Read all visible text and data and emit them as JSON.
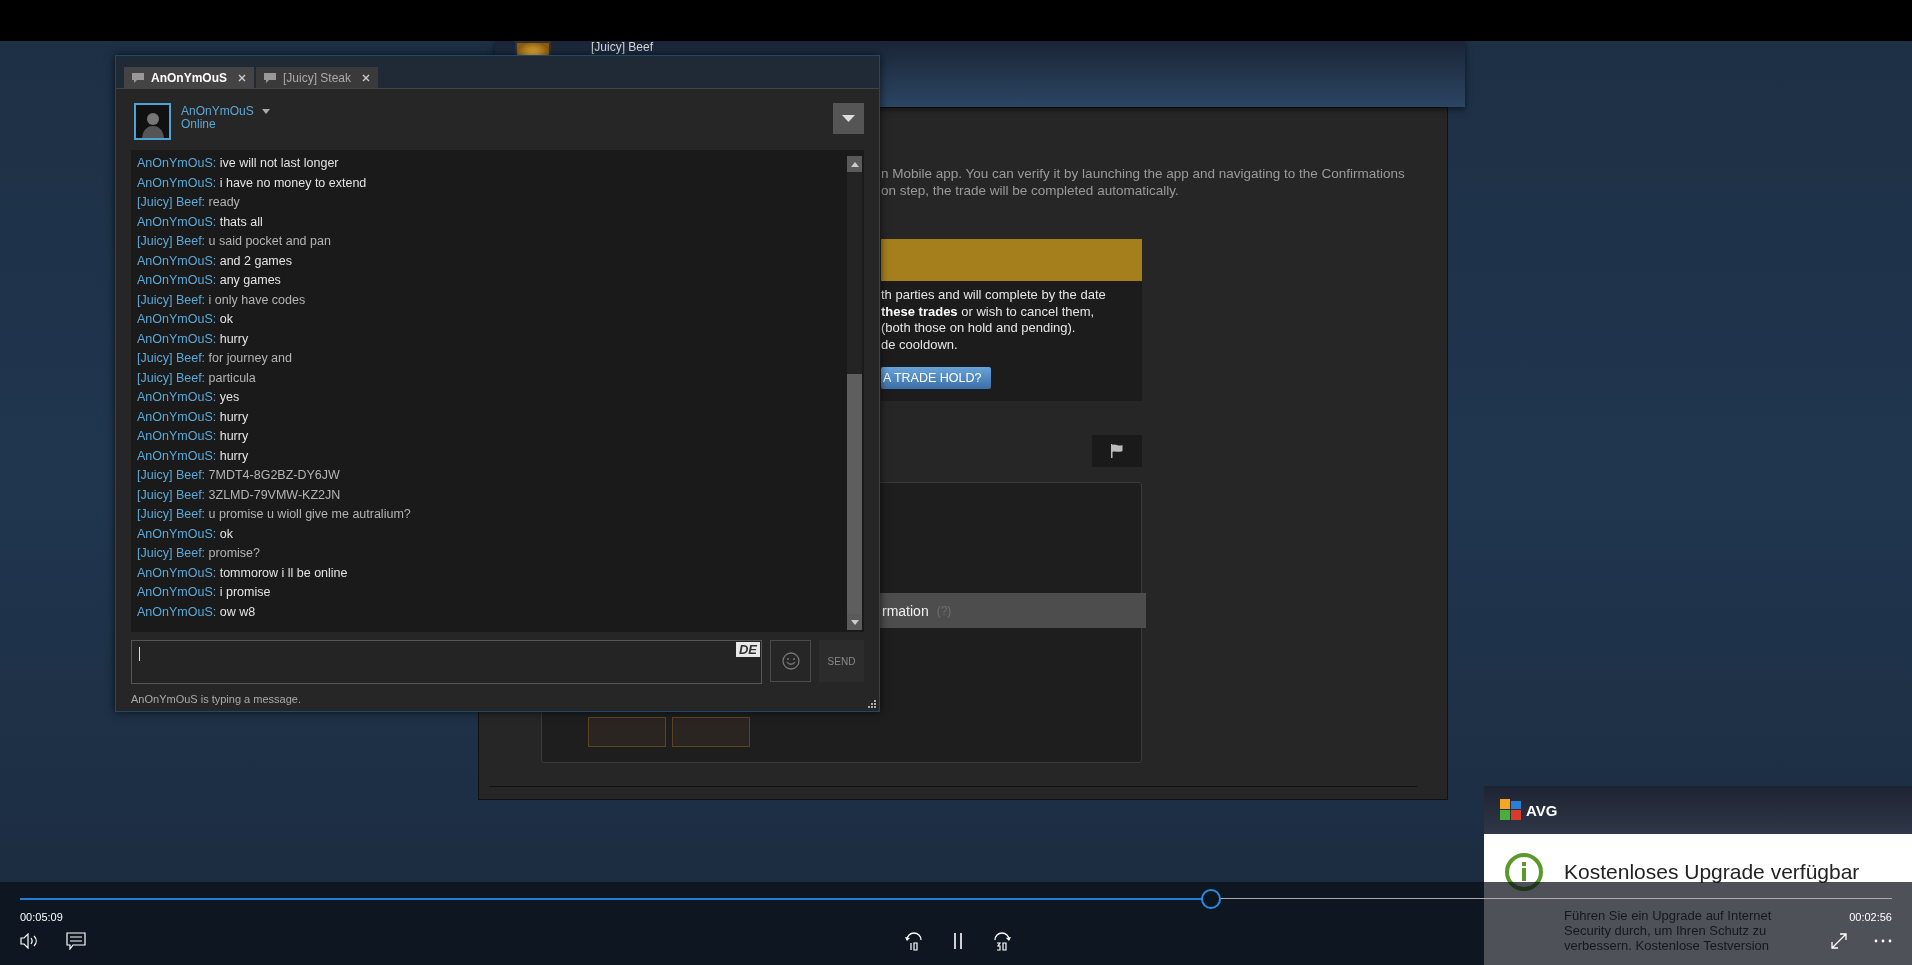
{
  "trade_page": {
    "partner_name": "[Juicy] Beef",
    "notice_lines": [
      "n Mobile app. You can verify it by launching the app and navigating to the Confirmations",
      "on step, the trade will be completed automatically."
    ],
    "hold_box": {
      "lines": [
        "th parties and will complete by the date",
        "**these trades** or wish to cancel them,",
        "(both those on hold and pending).",
        "de cooldown."
      ],
      "button": "A TRADE HOLD?"
    },
    "info_row": {
      "label": "rmation",
      "hint": "(?)"
    }
  },
  "chat": {
    "tabs": [
      {
        "label": "AnOnYmOuS",
        "selected": true
      },
      {
        "label": "[Juicy] Steak",
        "selected": false
      }
    ],
    "friend": {
      "name": "AnOnYmOuS",
      "status": "Online"
    },
    "messages": [
      {
        "kind": "self",
        "sender": "AnOnYmOuS:",
        "text": "ive will not last longer"
      },
      {
        "kind": "self",
        "sender": "AnOnYmOuS:",
        "text": "i have no money to extend"
      },
      {
        "kind": "friend",
        "sender": "[Juicy] Beef:",
        "text": "ready"
      },
      {
        "kind": "self",
        "sender": "AnOnYmOuS:",
        "text": "thats all"
      },
      {
        "kind": "friend",
        "sender": "[Juicy] Beef:",
        "text": "u said pocket and pan"
      },
      {
        "kind": "self",
        "sender": "AnOnYmOuS:",
        "text": "and 2  games"
      },
      {
        "kind": "self",
        "sender": "AnOnYmOuS:",
        "text": "any games"
      },
      {
        "kind": "friend",
        "sender": "[Juicy] Beef:",
        "text": "i only have codes"
      },
      {
        "kind": "self",
        "sender": "AnOnYmOuS:",
        "text": "ok"
      },
      {
        "kind": "self",
        "sender": "AnOnYmOuS:",
        "text": "hurry"
      },
      {
        "kind": "friend",
        "sender": "[Juicy] Beef:",
        "text": "for journey and"
      },
      {
        "kind": "friend",
        "sender": "[Juicy] Beef:",
        "text": "particula"
      },
      {
        "kind": "self",
        "sender": "AnOnYmOuS:",
        "text": "yes"
      },
      {
        "kind": "self",
        "sender": "AnOnYmOuS:",
        "text": "hurry"
      },
      {
        "kind": "self",
        "sender": "AnOnYmOuS:",
        "text": "hurry"
      },
      {
        "kind": "self",
        "sender": "AnOnYmOuS:",
        "text": "hurry"
      },
      {
        "kind": "friend",
        "sender": "[Juicy] Beef:",
        "text": "7MDT4-8G2BZ-DY6JW"
      },
      {
        "kind": "friend",
        "sender": "[Juicy] Beef:",
        "text": "3ZLMD-79VMW-KZ2JN"
      },
      {
        "kind": "friend",
        "sender": "[Juicy] Beef:",
        "text": "u promise u wioll give me autralium?"
      },
      {
        "kind": "self",
        "sender": "AnOnYmOuS:",
        "text": "ok"
      },
      {
        "kind": "friend",
        "sender": "[Juicy] Beef:",
        "text": "promise?"
      },
      {
        "kind": "self",
        "sender": "AnOnYmOuS:",
        "text": "tommorow i ll be online"
      },
      {
        "kind": "self",
        "sender": "AnOnYmOuS:",
        "text": "i promise"
      },
      {
        "kind": "self",
        "sender": "AnOnYmOuS:",
        "text": "ow w8"
      }
    ],
    "input_language": "DE",
    "send_button": "SEND",
    "typing_status": "AnOnYmOuS is typing a message."
  },
  "avg_popup": {
    "brand": "AVG",
    "title": "Kostenloses Upgrade verfügbar",
    "body": "Führen Sie ein Upgrade auf Internet Security durch, um Ihren Schutz zu verbessern. Kostenlose Testversion"
  },
  "player": {
    "elapsed": "00:05:09",
    "remaining": "00:02:56",
    "progress": {
      "level": 0.636
    }
  }
}
